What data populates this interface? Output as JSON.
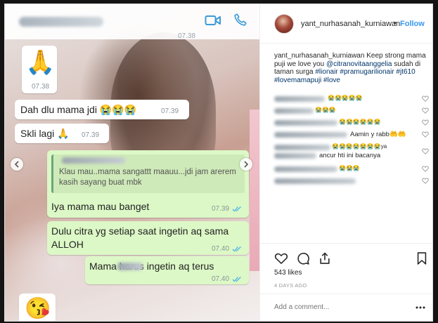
{
  "chat": {
    "top_time": "07.38",
    "prayer_emoji": "🙏",
    "prayer_time": "07.38",
    "msg1_text": "Dah dlu mama jdi 😭😭😭",
    "msg1_time": "07.39",
    "msg2_text": "Skli lagi 🙏",
    "msg2_time": "07.39",
    "quote_text": "Klau mau..mama sangattt maauu...jdi jam arerem kasih sayang buat mbk",
    "msg3_text": "Iya mama mau banget",
    "msg3_time": "07.39",
    "msg4_text": "Dulu citra yg setiap saat ingetin aq sama ALLOH",
    "msg4_time": "07.40",
    "msg5_text": "Mama harus ingetin aq terus",
    "msg5_time": "07.40",
    "kiss_emoji": "😘"
  },
  "post": {
    "username": "yant_nurhasanah_kurniawan",
    "dot": "•",
    "follow_label": "Follow",
    "caption_user": "yant_nurhasanah_kurniawan",
    "caption_text": " Keep strong mama puji we love you ",
    "caption_mention": "@citranovitaanggelia",
    "caption_text2": " sudah di taman surga ",
    "caption_tags": "#lionair #pramugarilionair #jt610 #lovemamapuji #love",
    "comments": [
      {
        "text": "😭😭😭😭😭"
      },
      {
        "text": "😭😭😭"
      },
      {
        "text": "😭😭😭😭😭😭"
      },
      {
        "text": "Aamin y rabb🤲🤲"
      },
      {
        "text": "😭😭😭😭😭😭😭ya"
      },
      {
        "text": "ancur hti ini bacanya"
      },
      {
        "text": "😭😭😭"
      }
    ],
    "likes": "543 likes",
    "ago": "4 DAYS AGO",
    "add_comment_placeholder": "Add a comment..."
  },
  "icons": {
    "video": "video-call-icon",
    "phone": "phone-call-icon",
    "heart": "heart-icon",
    "comment": "comment-icon",
    "share": "share-icon",
    "bookmark": "bookmark-icon",
    "more": "more-options-icon"
  },
  "colors": {
    "wa_blue": "#3a9bd8",
    "wa_green": "#dcf8c6",
    "follow_blue": "#3897f0",
    "hashtag": "#003569"
  }
}
